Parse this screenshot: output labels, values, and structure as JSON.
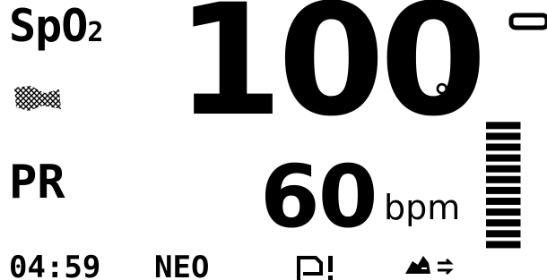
{
  "spo2": {
    "label_main": "SpO",
    "label_sub": "2",
    "value": "100",
    "unit": "%"
  },
  "pulse_rate": {
    "label": "PR",
    "value": "60",
    "unit": "bpm"
  },
  "signal_strength": {
    "bars_filled": 12,
    "bars_total": 12
  },
  "status_bar": {
    "time": "04:59",
    "mode": "NEO"
  },
  "icons": {
    "top_right": "battery-icon",
    "perfusion": "perfusion-indicator-icon",
    "alarm": "alarm-flag-icon",
    "sound": "alarm-audio-icon"
  },
  "colors": {
    "foreground": "#000000",
    "background": "#ffffff"
  }
}
